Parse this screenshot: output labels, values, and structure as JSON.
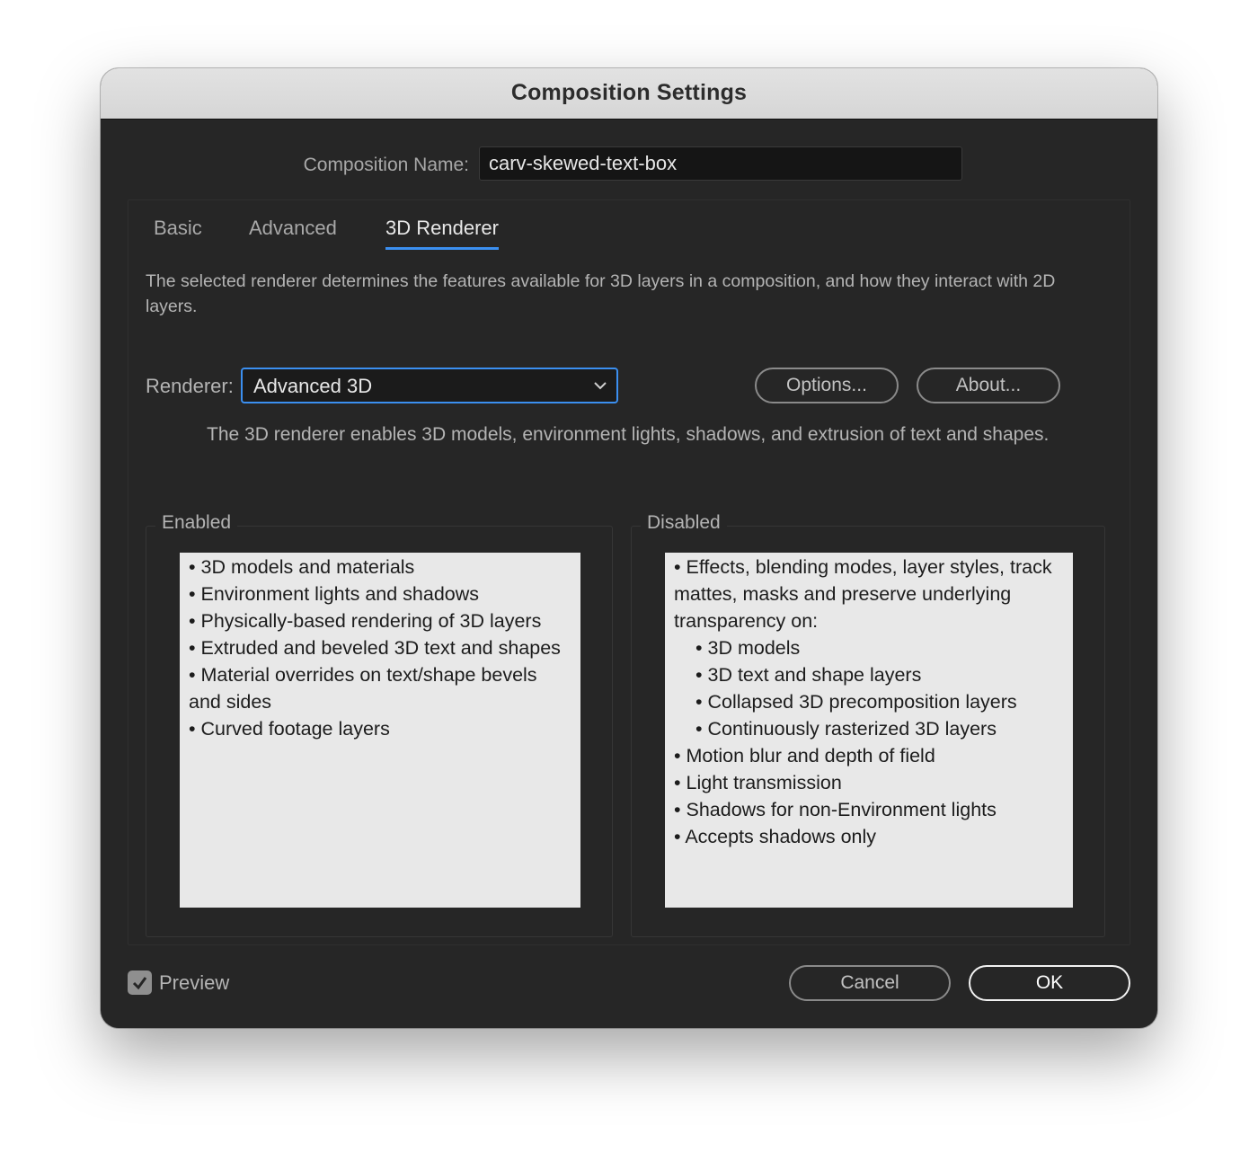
{
  "dialog": {
    "title": "Composition Settings"
  },
  "composition": {
    "name_label": "Composition Name:",
    "name_value": "carv-skewed-text-box"
  },
  "tabs": [
    {
      "label": "Basic",
      "active": false
    },
    {
      "label": "Advanced",
      "active": false
    },
    {
      "label": "3D Renderer",
      "active": true
    }
  ],
  "renderer_tab": {
    "description": "The selected renderer determines the features available for 3D layers in a composition, and how they interact with 2D layers.",
    "renderer_label": "Renderer:",
    "renderer_value": "Advanced 3D",
    "options_button": "Options...",
    "about_button": "About...",
    "renderer_info": "The 3D renderer enables 3D models, environment lights, shadows, and extrusion of text and shapes.",
    "enabled": {
      "label": "Enabled",
      "items": [
        {
          "text": "• 3D models and materials",
          "level": 0
        },
        {
          "text": "• Environment lights and shadows",
          "level": 0
        },
        {
          "text": "• Physically-based rendering of 3D layers",
          "level": 0
        },
        {
          "text": "• Extruded and beveled 3D text and shapes",
          "level": 0
        },
        {
          "text": "• Material overrides on text/shape bevels and sides",
          "level": 0
        },
        {
          "text": "• Curved footage layers",
          "level": 0
        }
      ]
    },
    "disabled": {
      "label": "Disabled",
      "items": [
        {
          "text": "• Effects, blending modes, layer styles, track mattes, masks and preserve underlying transparency on:",
          "level": 0
        },
        {
          "text": "• 3D models",
          "level": 1
        },
        {
          "text": "• 3D text and shape layers",
          "level": 1
        },
        {
          "text": "• Collapsed 3D precomposition layers",
          "level": 1
        },
        {
          "text": "• Continuously rasterized 3D layers",
          "level": 1
        },
        {
          "text": "• Motion blur and depth of field",
          "level": 0
        },
        {
          "text": "• Light transmission",
          "level": 0
        },
        {
          "text": "• Shadows for non-Environment lights",
          "level": 0
        },
        {
          "text": "• Accepts shadows only",
          "level": 0
        }
      ]
    }
  },
  "footer": {
    "preview_label": "Preview",
    "preview_checked": true,
    "cancel_button": "Cancel",
    "ok_button": "OK"
  },
  "colors": {
    "accent": "#3b8ff0",
    "window_bg": "#262626",
    "titlebar_bg": "#d6d6d6",
    "listbox_bg": "#e8e8e8"
  },
  "icons": {
    "dropdown": "chevron-down-icon",
    "checkbox": "checkmark-icon"
  }
}
